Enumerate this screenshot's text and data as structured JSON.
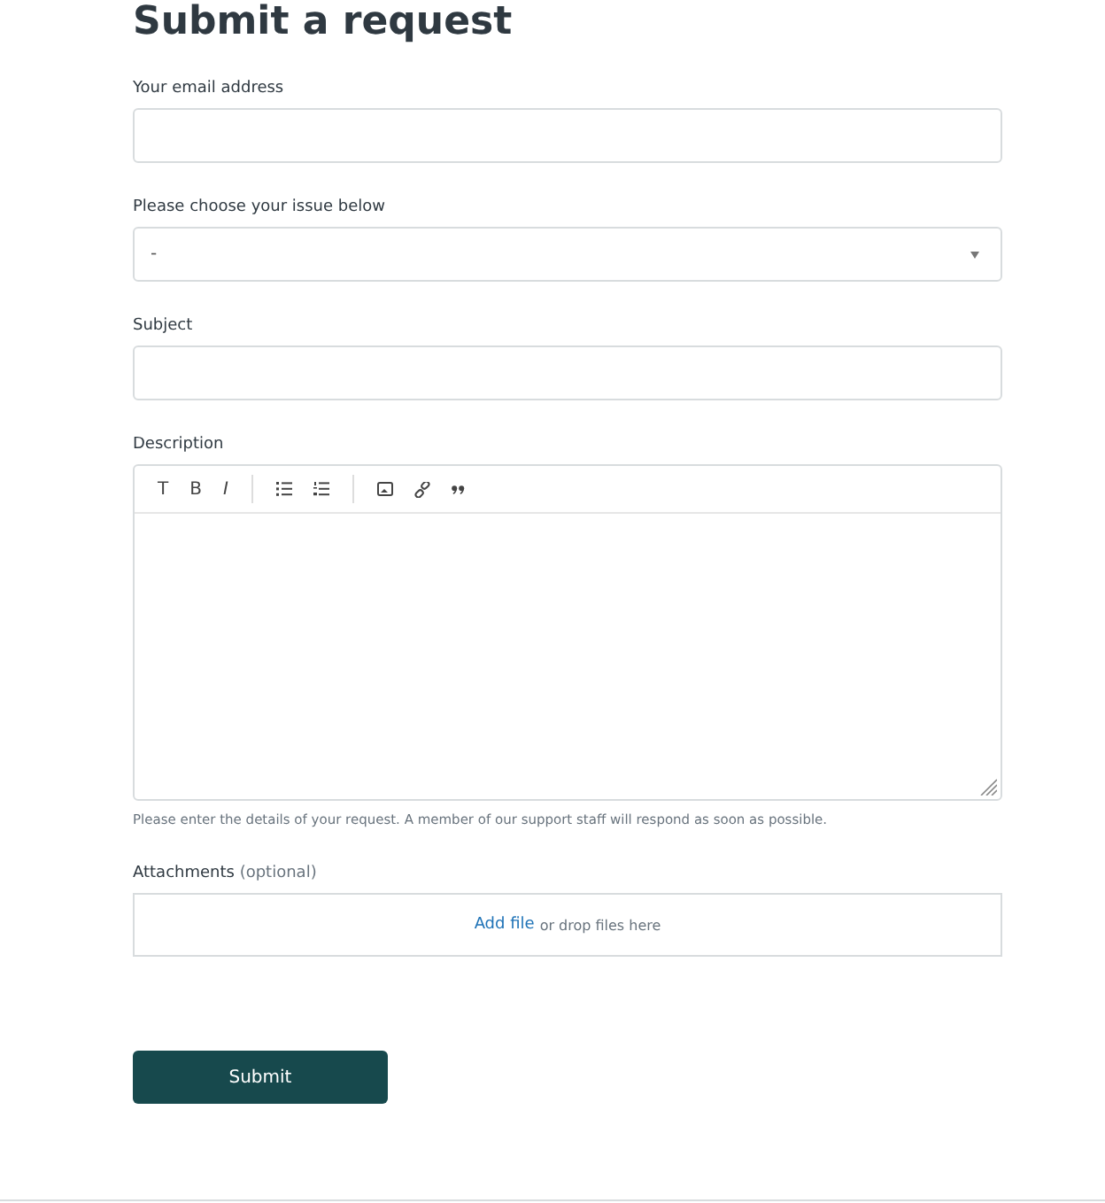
{
  "title": "Submit a request",
  "fields": [
    {
      "kind": "text",
      "label": "Your email address"
    },
    {
      "kind": "select",
      "label": "Please choose your issue below",
      "value": "-"
    },
    {
      "kind": "text",
      "label": "Subject"
    },
    {
      "kind": "editor",
      "label": "Description",
      "toolbar": [
        {
          "kind": "plain",
          "label": "T"
        },
        {
          "kind": "bold",
          "label": "B"
        },
        {
          "kind": "italic",
          "label": "I"
        },
        {
          "kind": "separator"
        },
        {
          "kind": "bullets"
        },
        {
          "kind": "numbers"
        },
        {
          "kind": "separator"
        },
        {
          "kind": "image"
        },
        {
          "kind": "link"
        },
        {
          "kind": "quote"
        }
      ],
      "hint": "Please enter the details of your request. A member of our support staff will respond as soon as possible."
    },
    {
      "kind": "upload",
      "label": "Attachments",
      "optional": "(optional)",
      "link": "Add file",
      "text": "or drop files here"
    }
  ],
  "submit": "Submit"
}
